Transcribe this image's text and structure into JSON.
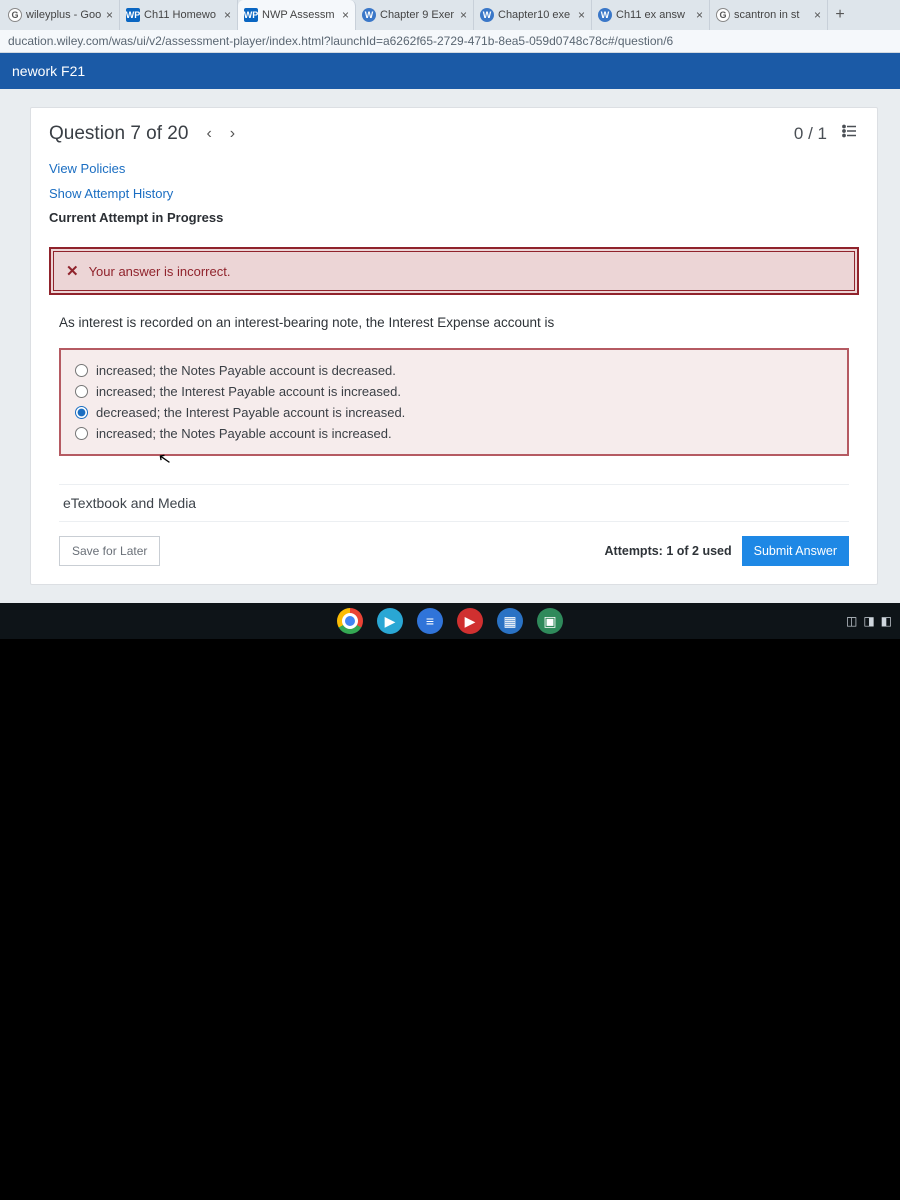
{
  "tabs": [
    {
      "label": "wileyplus - Goo",
      "favClass": "fav-g",
      "favText": "G"
    },
    {
      "label": "Ch11 Homewo",
      "favClass": "fav-wp",
      "favText": "WP"
    },
    {
      "label": "NWP Assessm",
      "favClass": "fav-wp",
      "favText": "WP",
      "active": true
    },
    {
      "label": "Chapter 9 Exer",
      "favClass": "fav-w",
      "favText": "W"
    },
    {
      "label": "Chapter10 exe",
      "favClass": "fav-w",
      "favText": "W"
    },
    {
      "label": "Ch11 ex answ",
      "favClass": "fav-w",
      "favText": "W"
    },
    {
      "label": "scantron in st",
      "favClass": "fav-g",
      "favText": "G"
    }
  ],
  "addressbar": "ducation.wiley.com/was/ui/v2/assessment-player/index.html?launchId=a6262f65-2729-471b-8ea5-059d0748c78c#/question/6",
  "bandTitle": "nework F21",
  "question": {
    "title": "Question 7 of 20",
    "prev": "‹",
    "next": "›",
    "score": "0 / 1",
    "viewPolicies": "View Policies",
    "showHistory": "Show Attempt History",
    "status": "Current Attempt in Progress",
    "bannerIcon": "✕",
    "bannerText": "Your answer is incorrect.",
    "stem": "As interest is recorded on an interest-bearing note, the Interest Expense account is",
    "options": [
      "increased; the Notes Payable account is decreased.",
      "increased; the Interest Payable account is increased.",
      "decreased; the Interest Payable account is increased.",
      "increased; the Notes Payable account is increased."
    ],
    "selectedIndex": 2,
    "etext": "eTextbook and Media",
    "saveLabel": "Save for Later",
    "attempts": "Attempts: 1 of 2 used",
    "submitLabel": "Submit Answer"
  },
  "shelf": {
    "play": "▶",
    "docs": "≡",
    "yt": "▶",
    "files": "▦",
    "gallery": "▣"
  },
  "tray": {
    "a": "◫",
    "b": "◨",
    "c": "◧"
  }
}
